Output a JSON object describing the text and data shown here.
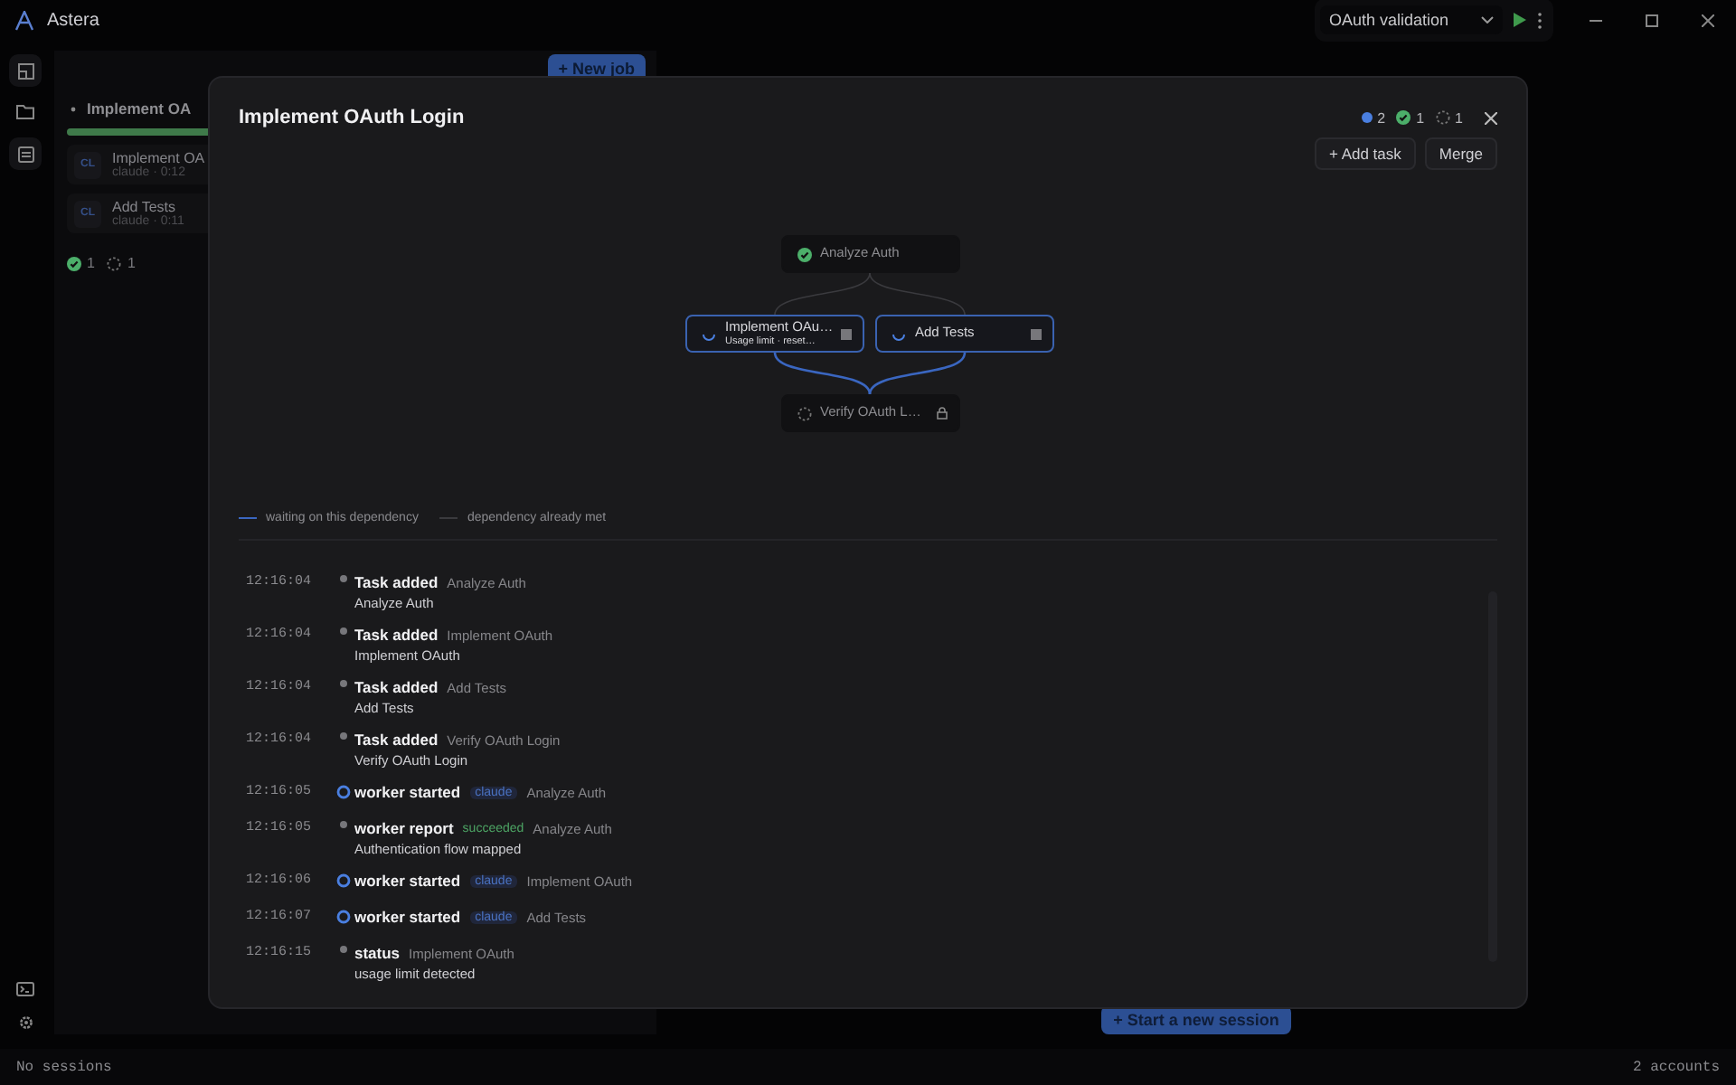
{
  "app": {
    "title": "Astera"
  },
  "toolbar": {
    "dropdown": "OAuth validation"
  },
  "rail": [
    {
      "kind": "layout",
      "selected": true
    },
    {
      "kind": "folder",
      "selected": false
    },
    {
      "kind": "board",
      "selected": true
    }
  ],
  "jobs_panel": {
    "new_job_button": "+ New job",
    "job_title": "Implement OA",
    "level": 1,
    "tasks": [
      {
        "badge": "CL",
        "title": "Implement OA",
        "meta": "claude · 0:12"
      },
      {
        "badge": "CL",
        "title": "Add Tests",
        "meta": "claude · 0:11"
      }
    ],
    "counts": [
      {
        "kind": "done",
        "count": "1"
      },
      {
        "kind": "waiting",
        "count": "1"
      }
    ]
  },
  "start_session_button": "+ Start a new session",
  "modal": {
    "title": "Implement OAuth Login",
    "counts": [
      {
        "kind": "running",
        "count": "2"
      },
      {
        "kind": "done",
        "count": "1"
      },
      {
        "kind": "waiting",
        "count": "1"
      }
    ],
    "buttons": [
      "+ Add task",
      "Merge"
    ],
    "graph": {
      "nodes": [
        {
          "label": "Analyze Auth",
          "kind": "done"
        },
        {
          "label": "Implement OAu…",
          "subtitle": "Usage limit · reset…",
          "kind": "running"
        },
        {
          "label": "Add Tests",
          "kind": "running"
        },
        {
          "label": "Verify OAuth L…",
          "kind": "locked"
        }
      ]
    },
    "legend": [
      {
        "kind": "waiting",
        "label": "waiting on this dependency"
      },
      {
        "kind": "met",
        "label": "dependency already met"
      }
    ],
    "log": [
      {
        "time": "12:16:04",
        "kind": "dot",
        "event": "Task added",
        "task": "Analyze Auth",
        "detail": "Analyze Auth"
      },
      {
        "time": "12:16:04",
        "kind": "dot",
        "event": "Task added",
        "task": "Implement OAuth",
        "detail": "Implement OAuth"
      },
      {
        "time": "12:16:04",
        "kind": "dot",
        "event": "Task added",
        "task": "Add Tests",
        "detail": "Add Tests"
      },
      {
        "time": "12:16:04",
        "kind": "dot",
        "event": "Task added",
        "task": "Verify OAuth Login",
        "detail": "Verify OAuth Login"
      },
      {
        "time": "12:16:05",
        "kind": "ring",
        "event": "worker started",
        "tag": {
          "kind": "agent",
          "text": "claude"
        },
        "task": "Analyze Auth"
      },
      {
        "time": "12:16:05",
        "kind": "dot",
        "event": "worker report",
        "tag": {
          "kind": "result",
          "text": "succeeded"
        },
        "task": "Analyze Auth",
        "detail": "Authentication flow mapped"
      },
      {
        "time": "12:16:06",
        "kind": "ring",
        "event": "worker started",
        "tag": {
          "kind": "agent",
          "text": "claude"
        },
        "task": "Implement OAuth"
      },
      {
        "time": "12:16:07",
        "kind": "ring",
        "event": "worker started",
        "tag": {
          "kind": "agent",
          "text": "claude"
        },
        "task": "Add Tests"
      },
      {
        "time": "12:16:15",
        "kind": "dot",
        "event": "status",
        "task": "Implement OAuth",
        "detail": "usage limit detected"
      }
    ]
  },
  "status_bar": {
    "left": "No sessions",
    "right": "2 accounts"
  }
}
